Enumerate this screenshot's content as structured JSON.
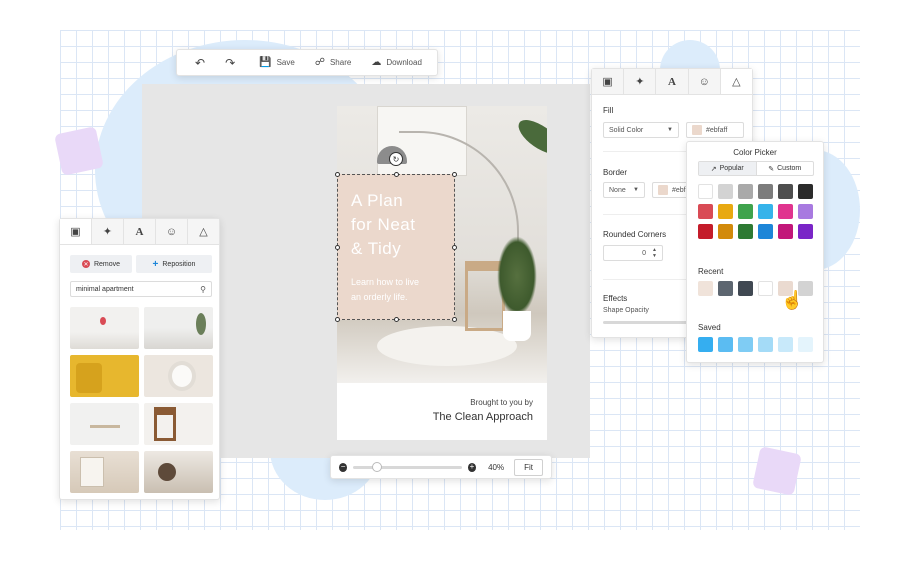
{
  "toolbar": {
    "save_label": "Save",
    "share_label": "Share",
    "download_label": "Download",
    "undo_icon": "undo-icon",
    "redo_icon": "redo-icon"
  },
  "left_panel": {
    "remove_label": "Remove",
    "reposition_label": "Reposition",
    "search_value": "minimal apartment"
  },
  "card": {
    "headline_line1": "A Plan",
    "headline_line2": "for Neat",
    "headline_line3": "& Tidy",
    "subline1": "Learn how to live",
    "subline2": "an orderly life.",
    "footer_small": "Brought to you by",
    "footer_brand": "The Clean Approach",
    "overlay_color": "#ebd8cc"
  },
  "zoom": {
    "percent": "40%",
    "fit_label": "Fit",
    "level": 0.2
  },
  "right_panel": {
    "fill_label": "Fill",
    "fill_type": "Solid Color",
    "fill_hex": "#ebfaff",
    "border_label": "Border",
    "border_type": "None",
    "border_hex": "#ebfa",
    "rounded_label": "Rounded Corners",
    "rounded_value": "0",
    "effects_label": "Effects",
    "opacity_label": "Shape Opacity"
  },
  "color_picker": {
    "title": "Color Picker",
    "popular_tab": "Popular",
    "custom_tab": "Custom",
    "recent_label": "Recent",
    "saved_label": "Saved",
    "popular_colors": [
      "#ffffff",
      "#d3d3d3",
      "#a9a9a9",
      "#7c7c7c",
      "#4e4e4e",
      "#2b2b2b",
      "#d94b55",
      "#e8a911",
      "#3fa34d",
      "#35b3ea",
      "#e0348f",
      "#a87ae0",
      "#c41c2a",
      "#d28a0b",
      "#2e7a33",
      "#1d86d8",
      "#c2177a",
      "#7a25c7"
    ],
    "recent_colors": [
      "#f0e3da",
      "#5d6670",
      "#404852",
      "#ffffff",
      "#eadad0",
      "#d3d3d3"
    ],
    "saved_colors": [
      "#35aef0",
      "#5bbcf2",
      "#7fccf4",
      "#a4dbf7",
      "#c8e9fa",
      "#e4f4fc"
    ]
  }
}
